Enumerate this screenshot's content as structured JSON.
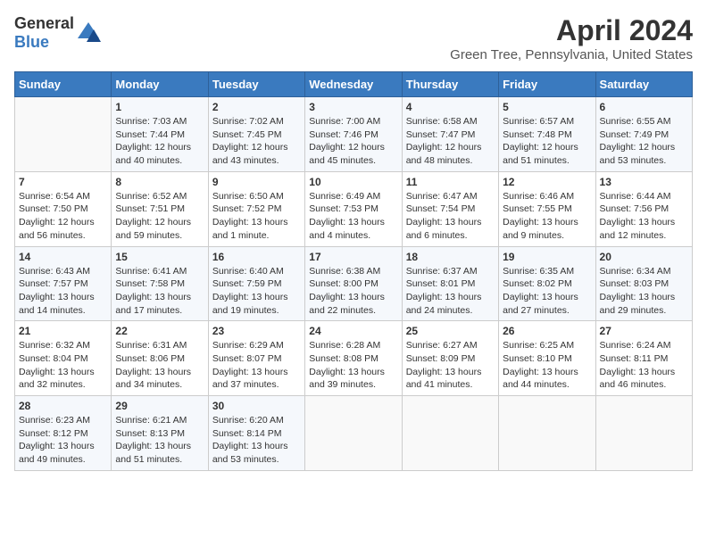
{
  "header": {
    "logo_general": "General",
    "logo_blue": "Blue",
    "title": "April 2024",
    "subtitle": "Green Tree, Pennsylvania, United States"
  },
  "calendar": {
    "days_of_week": [
      "Sunday",
      "Monday",
      "Tuesday",
      "Wednesday",
      "Thursday",
      "Friday",
      "Saturday"
    ],
    "weeks": [
      [
        {
          "day": "",
          "detail": ""
        },
        {
          "day": "1",
          "detail": "Sunrise: 7:03 AM\nSunset: 7:44 PM\nDaylight: 12 hours\nand 40 minutes."
        },
        {
          "day": "2",
          "detail": "Sunrise: 7:02 AM\nSunset: 7:45 PM\nDaylight: 12 hours\nand 43 minutes."
        },
        {
          "day": "3",
          "detail": "Sunrise: 7:00 AM\nSunset: 7:46 PM\nDaylight: 12 hours\nand 45 minutes."
        },
        {
          "day": "4",
          "detail": "Sunrise: 6:58 AM\nSunset: 7:47 PM\nDaylight: 12 hours\nand 48 minutes."
        },
        {
          "day": "5",
          "detail": "Sunrise: 6:57 AM\nSunset: 7:48 PM\nDaylight: 12 hours\nand 51 minutes."
        },
        {
          "day": "6",
          "detail": "Sunrise: 6:55 AM\nSunset: 7:49 PM\nDaylight: 12 hours\nand 53 minutes."
        }
      ],
      [
        {
          "day": "7",
          "detail": "Sunrise: 6:54 AM\nSunset: 7:50 PM\nDaylight: 12 hours\nand 56 minutes."
        },
        {
          "day": "8",
          "detail": "Sunrise: 6:52 AM\nSunset: 7:51 PM\nDaylight: 12 hours\nand 59 minutes."
        },
        {
          "day": "9",
          "detail": "Sunrise: 6:50 AM\nSunset: 7:52 PM\nDaylight: 13 hours\nand 1 minute."
        },
        {
          "day": "10",
          "detail": "Sunrise: 6:49 AM\nSunset: 7:53 PM\nDaylight: 13 hours\nand 4 minutes."
        },
        {
          "day": "11",
          "detail": "Sunrise: 6:47 AM\nSunset: 7:54 PM\nDaylight: 13 hours\nand 6 minutes."
        },
        {
          "day": "12",
          "detail": "Sunrise: 6:46 AM\nSunset: 7:55 PM\nDaylight: 13 hours\nand 9 minutes."
        },
        {
          "day": "13",
          "detail": "Sunrise: 6:44 AM\nSunset: 7:56 PM\nDaylight: 13 hours\nand 12 minutes."
        }
      ],
      [
        {
          "day": "14",
          "detail": "Sunrise: 6:43 AM\nSunset: 7:57 PM\nDaylight: 13 hours\nand 14 minutes."
        },
        {
          "day": "15",
          "detail": "Sunrise: 6:41 AM\nSunset: 7:58 PM\nDaylight: 13 hours\nand 17 minutes."
        },
        {
          "day": "16",
          "detail": "Sunrise: 6:40 AM\nSunset: 7:59 PM\nDaylight: 13 hours\nand 19 minutes."
        },
        {
          "day": "17",
          "detail": "Sunrise: 6:38 AM\nSunset: 8:00 PM\nDaylight: 13 hours\nand 22 minutes."
        },
        {
          "day": "18",
          "detail": "Sunrise: 6:37 AM\nSunset: 8:01 PM\nDaylight: 13 hours\nand 24 minutes."
        },
        {
          "day": "19",
          "detail": "Sunrise: 6:35 AM\nSunset: 8:02 PM\nDaylight: 13 hours\nand 27 minutes."
        },
        {
          "day": "20",
          "detail": "Sunrise: 6:34 AM\nSunset: 8:03 PM\nDaylight: 13 hours\nand 29 minutes."
        }
      ],
      [
        {
          "day": "21",
          "detail": "Sunrise: 6:32 AM\nSunset: 8:04 PM\nDaylight: 13 hours\nand 32 minutes."
        },
        {
          "day": "22",
          "detail": "Sunrise: 6:31 AM\nSunset: 8:06 PM\nDaylight: 13 hours\nand 34 minutes."
        },
        {
          "day": "23",
          "detail": "Sunrise: 6:29 AM\nSunset: 8:07 PM\nDaylight: 13 hours\nand 37 minutes."
        },
        {
          "day": "24",
          "detail": "Sunrise: 6:28 AM\nSunset: 8:08 PM\nDaylight: 13 hours\nand 39 minutes."
        },
        {
          "day": "25",
          "detail": "Sunrise: 6:27 AM\nSunset: 8:09 PM\nDaylight: 13 hours\nand 41 minutes."
        },
        {
          "day": "26",
          "detail": "Sunrise: 6:25 AM\nSunset: 8:10 PM\nDaylight: 13 hours\nand 44 minutes."
        },
        {
          "day": "27",
          "detail": "Sunrise: 6:24 AM\nSunset: 8:11 PM\nDaylight: 13 hours\nand 46 minutes."
        }
      ],
      [
        {
          "day": "28",
          "detail": "Sunrise: 6:23 AM\nSunset: 8:12 PM\nDaylight: 13 hours\nand 49 minutes."
        },
        {
          "day": "29",
          "detail": "Sunrise: 6:21 AM\nSunset: 8:13 PM\nDaylight: 13 hours\nand 51 minutes."
        },
        {
          "day": "30",
          "detail": "Sunrise: 6:20 AM\nSunset: 8:14 PM\nDaylight: 13 hours\nand 53 minutes."
        },
        {
          "day": "",
          "detail": ""
        },
        {
          "day": "",
          "detail": ""
        },
        {
          "day": "",
          "detail": ""
        },
        {
          "day": "",
          "detail": ""
        }
      ]
    ]
  }
}
